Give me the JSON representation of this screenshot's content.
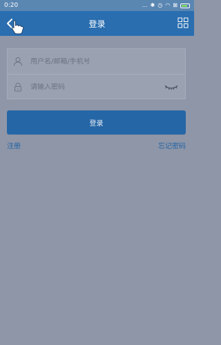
{
  "status_bar": {
    "time": "0:20",
    "icons": [
      "more-dots-icon",
      "bluetooth-icon",
      "alarm-icon",
      "wifi-icon",
      "sim-icon",
      "battery-icon"
    ],
    "dots": "...",
    "bluetooth": "✱",
    "alarm": "◷",
    "wifi": "◠",
    "sim": "⊠"
  },
  "header": {
    "title": "登录",
    "back_icon": "back-arrow-icon",
    "grid_icon": "grid-icon"
  },
  "form": {
    "username": {
      "placeholder": "用户名/邮箱/手机号",
      "value": "",
      "icon": "user-icon"
    },
    "password": {
      "placeholder": "请输入密码",
      "value": "",
      "icon": "lock-icon",
      "toggle_icon": "eye-closed-icon"
    }
  },
  "login_button": {
    "label": "登录"
  },
  "links": {
    "register": "注册",
    "forgot_password": "忘记密码"
  },
  "colors": {
    "status_bar": "#5a86b2",
    "title_bar": "#2a6eb0",
    "background": "#8e96a8",
    "button": "#2566a6",
    "link": "#2463a3"
  }
}
